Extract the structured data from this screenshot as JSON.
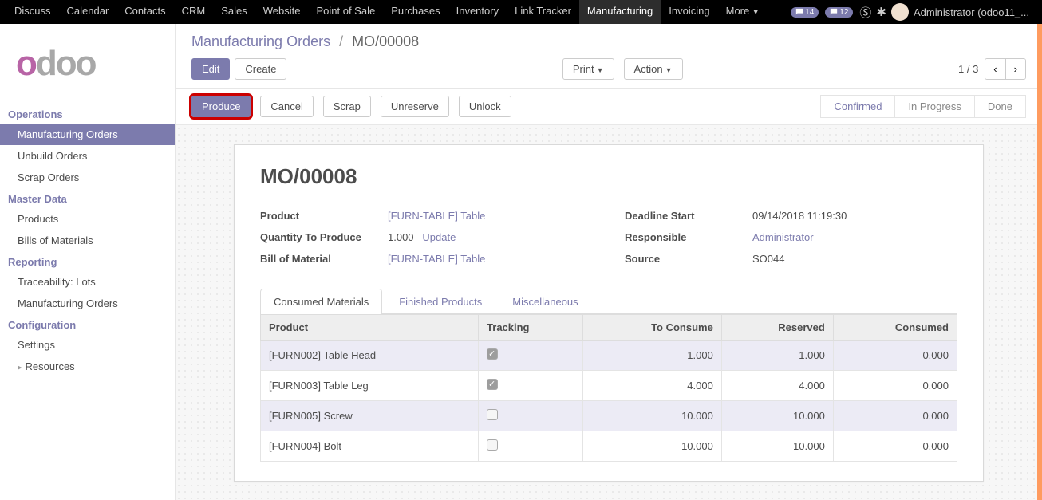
{
  "topnav": {
    "items": [
      "Discuss",
      "Calendar",
      "Contacts",
      "CRM",
      "Sales",
      "Website",
      "Point of Sale",
      "Purchases",
      "Inventory",
      "Link Tracker",
      "Manufacturing",
      "Invoicing",
      "More"
    ],
    "active": "Manufacturing",
    "badges": {
      "discuss": "14",
      "calls": "12"
    },
    "user": "Administrator (odoo11_..."
  },
  "sidebar": {
    "sections": [
      {
        "header": "Operations",
        "items": [
          "Manufacturing Orders",
          "Unbuild Orders",
          "Scrap Orders"
        ],
        "active": "Manufacturing Orders"
      },
      {
        "header": "Master Data",
        "items": [
          "Products",
          "Bills of Materials"
        ]
      },
      {
        "header": "Reporting",
        "items": [
          "Traceability: Lots",
          "Manufacturing Orders"
        ]
      },
      {
        "header": "Configuration",
        "items": [
          "Settings",
          "Resources"
        ]
      }
    ]
  },
  "breadcrumb": {
    "parent": "Manufacturing Orders",
    "current": "MO/00008"
  },
  "controls": {
    "edit": "Edit",
    "create": "Create",
    "print": "Print",
    "action": "Action",
    "pager": "1 / 3"
  },
  "actions": {
    "produce": "Produce",
    "cancel": "Cancel",
    "scrap": "Scrap",
    "unreserve": "Unreserve",
    "unlock": "Unlock"
  },
  "status": [
    "Confirmed",
    "In Progress",
    "Done"
  ],
  "status_active": "Confirmed",
  "order": {
    "name": "MO/00008",
    "labels": {
      "product": "Product",
      "qty": "Quantity To Produce",
      "bom": "Bill of Material",
      "deadline": "Deadline Start",
      "resp": "Responsible",
      "source": "Source"
    },
    "product": "[FURN-TABLE] Table",
    "qty": "1.000",
    "update": "Update",
    "bom": "[FURN-TABLE] Table",
    "deadline": "09/14/2018 11:19:30",
    "responsible": "Administrator",
    "source": "SO044"
  },
  "tabs": {
    "consumed": "Consumed Materials",
    "finished": "Finished Products",
    "misc": "Miscellaneous",
    "active": "consumed"
  },
  "table": {
    "headers": {
      "product": "Product",
      "tracking": "Tracking",
      "toconsume": "To Consume",
      "reserved": "Reserved",
      "consumed": "Consumed"
    },
    "rows": [
      {
        "product": "[FURN002] Table Head",
        "tracking": true,
        "toconsume": "1.000",
        "reserved": "1.000",
        "consumed": "0.000"
      },
      {
        "product": "[FURN003] Table Leg",
        "tracking": true,
        "toconsume": "4.000",
        "reserved": "4.000",
        "consumed": "0.000"
      },
      {
        "product": "[FURN005] Screw",
        "tracking": false,
        "toconsume": "10.000",
        "reserved": "10.000",
        "consumed": "0.000"
      },
      {
        "product": "[FURN004] Bolt",
        "tracking": false,
        "toconsume": "10.000",
        "reserved": "10.000",
        "consumed": "0.000"
      }
    ]
  }
}
